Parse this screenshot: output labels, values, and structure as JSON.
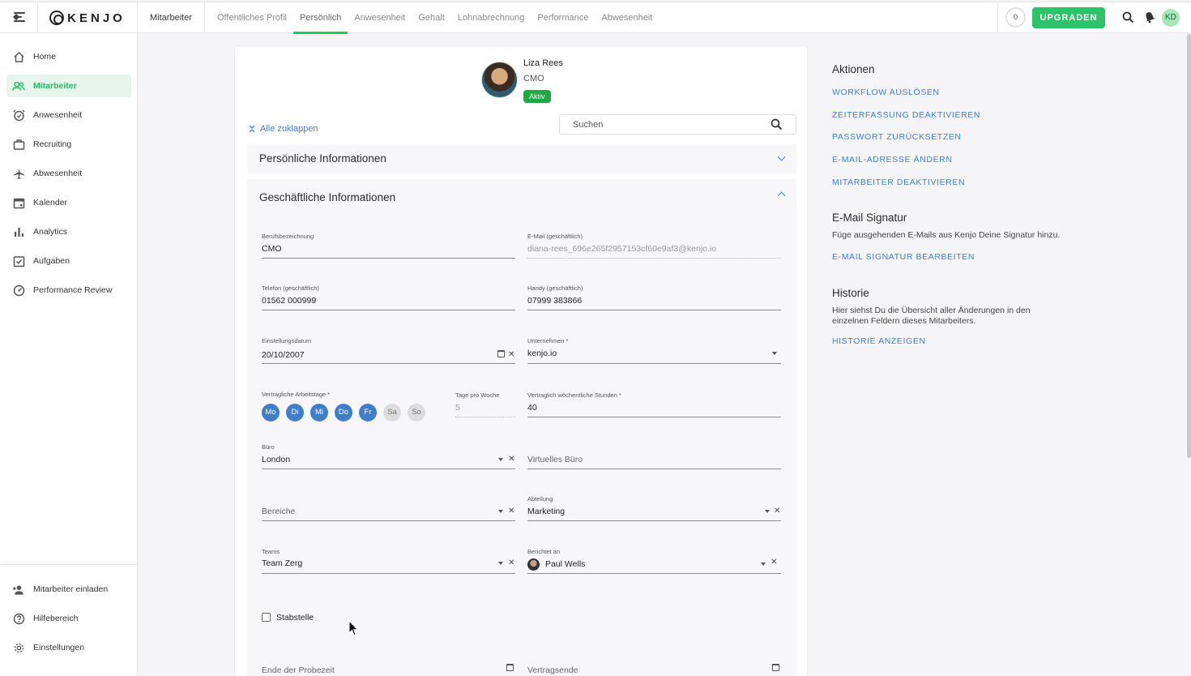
{
  "header": {
    "logo_text": "KENJO",
    "section": "Mitarbeiter",
    "tabs": [
      "Öffentliches Profil",
      "Persönlich",
      "Anwesenheit",
      "Gehalt",
      "Lohnabrechnung",
      "Performance",
      "Abwesenheit"
    ],
    "active_tab": "Persönlich",
    "counter": "0",
    "upgrade_label": "UPGRADEN",
    "avatar_initials": "KD"
  },
  "sidebar": {
    "items": [
      {
        "label": "Home",
        "icon": "home-icon"
      },
      {
        "label": "Mitarbeiter",
        "icon": "people-icon",
        "active": true
      },
      {
        "label": "Anwesenheit",
        "icon": "alarm-clock-icon"
      },
      {
        "label": "Recruiting",
        "icon": "briefcase-icon"
      },
      {
        "label": "Abwesenheit",
        "icon": "airplane-icon"
      },
      {
        "label": "Kalender",
        "icon": "calendar-icon"
      },
      {
        "label": "Analytics",
        "icon": "bar-chart-icon"
      },
      {
        "label": "Aufgaben",
        "icon": "task-check-icon"
      },
      {
        "label": "Performance Review",
        "icon": "gauge-icon"
      }
    ],
    "bottom_items": [
      {
        "label": "Mitarbeiter einladen",
        "icon": "add-person-icon"
      },
      {
        "label": "Hilfebereich",
        "icon": "help-icon"
      },
      {
        "label": "Einstellungen",
        "icon": "gear-icon"
      }
    ]
  },
  "profile": {
    "name": "Liza Rees",
    "role": "CMO",
    "status": "Aktiv"
  },
  "toolbar": {
    "collapse_all": "Alle zuklappen",
    "search_placeholder": "Suchen"
  },
  "sections": {
    "personal": "Persönliche Informationen",
    "business": "Geschäftliche Informationen"
  },
  "fields": {
    "job_title": {
      "label": "Berufsbezeichnung",
      "value": "CMO"
    },
    "work_email": {
      "label": "E-Mail (geschäftlich)",
      "value": "diana-rees_696e265f2957153cf60e9af3@kenjo.io"
    },
    "work_phone": {
      "label": "Telefon (geschäftlich)",
      "value": "01562 000999"
    },
    "work_mobile": {
      "label": "Handy (geschäftlich)",
      "value": "07999 383866"
    },
    "start_date": {
      "label": "Einstellungsdatum",
      "value": "20/10/2007"
    },
    "company": {
      "label": "Unternehmen *",
      "value": "kenjo.io"
    },
    "workdays": {
      "label": "Vertragliche Arbeitstage *",
      "days": [
        {
          "label": "Mo",
          "on": true
        },
        {
          "label": "Di",
          "on": true
        },
        {
          "label": "Mi",
          "on": true
        },
        {
          "label": "Do",
          "on": true
        },
        {
          "label": "Fr",
          "on": true
        },
        {
          "label": "Sa",
          "on": false
        },
        {
          "label": "So",
          "on": false
        }
      ]
    },
    "days_per_week": {
      "label": "Tage pro Woche",
      "value": "5"
    },
    "weekly_hours": {
      "label": "Vertraglich wöchentliche Stunden *",
      "value": "40"
    },
    "office": {
      "label": "Büro",
      "value": "London"
    },
    "virtual_office": {
      "placeholder": "Virtuelles Büro"
    },
    "areas": {
      "placeholder": "Bereiche"
    },
    "department": {
      "label": "Abteilung",
      "value": "Marketing"
    },
    "teams": {
      "label": "Teams",
      "value": "Team Zerg"
    },
    "reports_to": {
      "label": "Berichtet an",
      "value": "Paul Wells"
    },
    "staff_position": {
      "label": "Stabstelle",
      "checked": false
    },
    "probation_end": {
      "placeholder": "Ende der Probezeit"
    },
    "contract_end": {
      "placeholder": "Vertragsende"
    }
  },
  "actions": {
    "title": "Aktionen",
    "links": [
      "WORKFLOW AUSLÖSEN",
      "ZEITERFASSUNG DEAKTIVIEREN",
      "PASSWORT ZURÜCKSETZEN",
      "E-MAIL-ADRESSE ÄNDERN",
      "MITARBEITER DEAKTIVIEREN"
    ]
  },
  "signature": {
    "title": "E-Mail Signatur",
    "text": "Füge ausgehenden E-Mails aus Kenjo Deine Signatur hinzu.",
    "link": "E-MAIL SIGNATUR BEARBEITEN"
  },
  "history": {
    "title": "Historie",
    "text": "Hier siehst Du die Übersicht aller Änderungen in den einzelnen Feldern dieses Mitarbeiters.",
    "link": "HISTORIE ANZEIGEN"
  },
  "colors": {
    "accent_green": "#2ec36a",
    "link_blue": "#3f7fca",
    "status_green": "#20a746"
  }
}
